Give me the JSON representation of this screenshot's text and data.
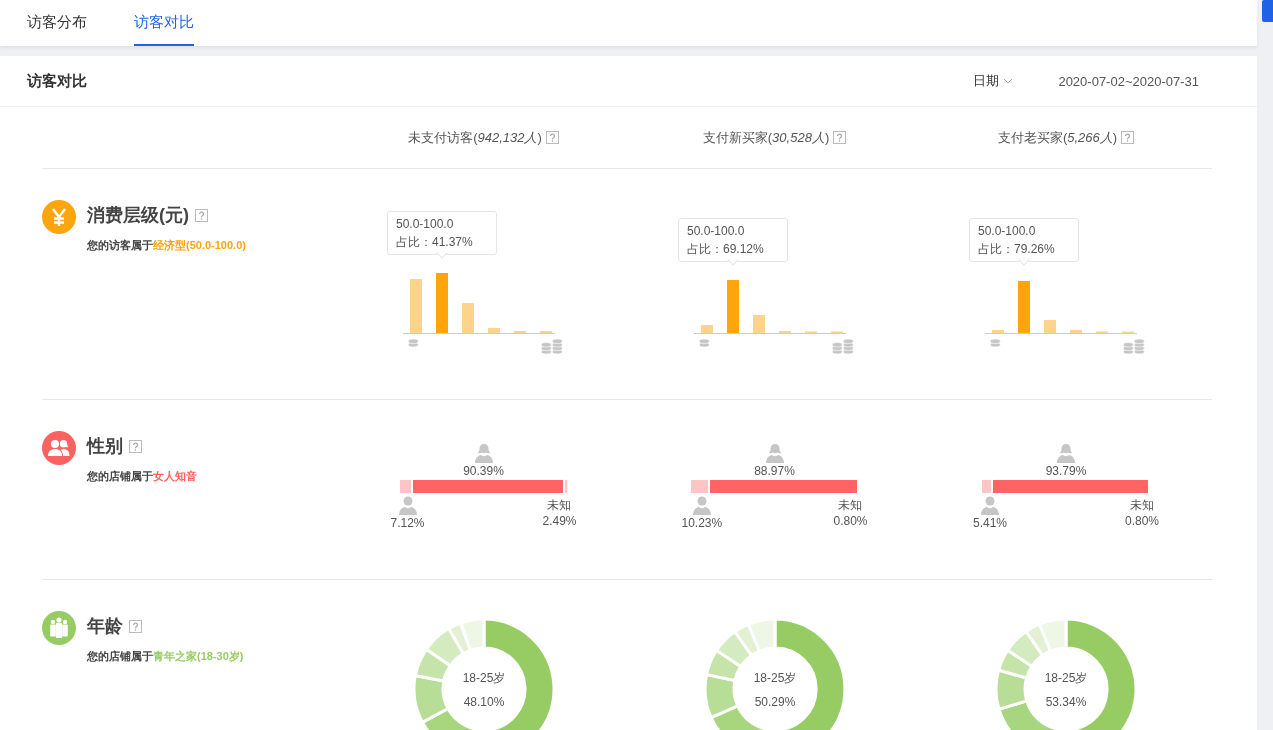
{
  "tabs": [
    {
      "label": "访客分布",
      "selected": false
    },
    {
      "label": "访客对比",
      "selected": true
    }
  ],
  "card": {
    "title": "访客对比",
    "date_label": "日期",
    "date_range": "2020-07-02~2020-07-31"
  },
  "columns": [
    {
      "heading": "未支付访客(*942,132人*)"
    },
    {
      "heading": "支付新买家(*30,528人*)"
    },
    {
      "heading": "支付老买家(*5,266人*)"
    }
  ],
  "sections": [
    {
      "kind": "spend",
      "title": "消费层级(元)",
      "color": "#fea40c",
      "summary_prefix": "您的访客属于",
      "summary_highlight": "经济型(50.0-100.0)",
      "columns": [
        {
          "tooltip_range": "50.0-100.0",
          "tooltip_share": "占比：41.37%"
        },
        {
          "tooltip_range": "50.0-100.0",
          "tooltip_share": "占比：69.12%"
        },
        {
          "tooltip_range": "50.0-100.0",
          "tooltip_share": "占比：79.26%"
        }
      ]
    },
    {
      "kind": "gender",
      "title": "性别",
      "color": "#fb6260",
      "summary_prefix": "您的店铺属于",
      "summary_highlight": "女人知音",
      "columns": [
        {
          "segments": [
            {
              "kind": "male",
              "level": 0.0712,
              "value": "7.12%"
            },
            {
              "kind": "female",
              "level": 0.9039,
              "value": "90.39%"
            },
            {
              "kind": "unknown",
              "level": 0.0249,
              "label": "未知",
              "value": "2.49%"
            }
          ]
        },
        {
          "segments": [
            {
              "kind": "male",
              "level": 0.1023,
              "value": "10.23%"
            },
            {
              "kind": "female",
              "level": 0.8897,
              "value": "88.97%"
            },
            {
              "kind": "unknown",
              "level": 0.008,
              "label": "未知",
              "value": "0.80%"
            }
          ]
        },
        {
          "segments": [
            {
              "kind": "male",
              "level": 0.0541,
              "value": "5.41%"
            },
            {
              "kind": "female",
              "level": 0.9379,
              "value": "93.79%"
            },
            {
              "kind": "unknown",
              "level": 0.008,
              "label": "未知",
              "value": "0.80%"
            }
          ]
        }
      ]
    },
    {
      "kind": "age",
      "title": "年龄",
      "color": "#97cc64",
      "summary_prefix": "您的店铺属于",
      "summary_highlight": "青年之家(18-30岁)",
      "columns": [
        {
          "label": "18-25岁",
          "value": "48.10%"
        },
        {
          "label": "18-25岁",
          "value": "50.29%"
        },
        {
          "label": "18-25岁",
          "value": "53.34%"
        }
      ]
    }
  ]
}
